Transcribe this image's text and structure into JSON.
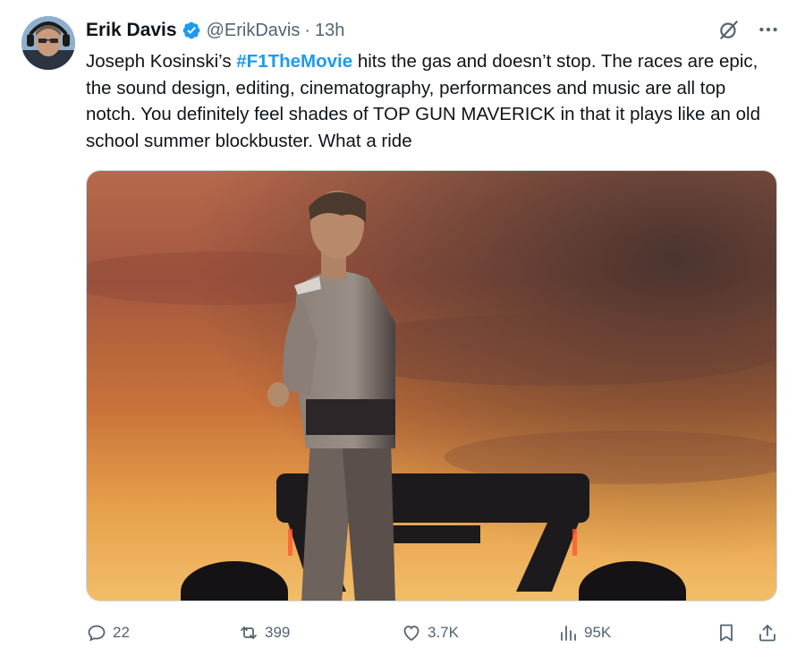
{
  "author": {
    "name": "Erik Davis",
    "handle": "@ErikDavis",
    "separator": "·",
    "time": "13h"
  },
  "tweet": {
    "text_before": "Joseph Kosinski’s ",
    "hashtag": "#F1TheMovie",
    "text_after": " hits the gas and doesn’t stop. The races are epic, the sound design, editing, cinematography, performances and music are all top notch. You definitely feel shades of TOP GUN MAVERICK in that it plays like an old school summer blockbuster. What a ride"
  },
  "metrics": {
    "replies": "22",
    "reposts": "399",
    "likes": "3.7K",
    "views": "95K"
  },
  "colors": {
    "link": "#1d9bf0",
    "verified": "#1d9bf0",
    "muted": "#536471"
  },
  "icons": [
    "verified-badge-icon",
    "grok-icon",
    "more-icon",
    "reply-icon",
    "repost-icon",
    "like-icon",
    "views-icon",
    "bookmark-icon",
    "share-icon"
  ]
}
